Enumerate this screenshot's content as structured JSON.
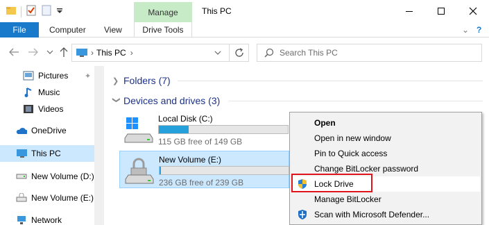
{
  "window": {
    "title": "This PC",
    "context_tab": "Manage"
  },
  "ribbon": {
    "tabs": [
      "File",
      "Computer",
      "View",
      "Drive Tools"
    ]
  },
  "nav": {
    "path": [
      "This PC"
    ],
    "search_placeholder": "Search This PC"
  },
  "sidebar": {
    "items": [
      {
        "label": "Pictures",
        "icon": "pictures-icon",
        "pinned": true
      },
      {
        "label": "Music",
        "icon": "music-icon"
      },
      {
        "label": "Videos",
        "icon": "videos-icon"
      },
      {
        "label": "OneDrive",
        "icon": "onedrive-icon"
      },
      {
        "label": "This PC",
        "icon": "this-pc-icon",
        "selected": true
      },
      {
        "label": "New Volume (D:)",
        "icon": "drive-icon"
      },
      {
        "label": "New Volume (E:)",
        "icon": "drive-icon"
      },
      {
        "label": "Network",
        "icon": "network-icon"
      }
    ]
  },
  "main": {
    "folders_header": "Folders (7)",
    "devices_header": "Devices and drives (3)",
    "drives": [
      {
        "name": "Local Disk (C:)",
        "free": "115 GB free of 149 GB",
        "used_fraction": 0.23
      },
      {
        "name": "New Volume (E:)",
        "free": "236 GB free of 239 GB",
        "used_fraction": 0.01,
        "selected": true
      }
    ]
  },
  "context_menu": {
    "items": [
      {
        "label": "Open",
        "bold": true
      },
      {
        "label": "Open in new window"
      },
      {
        "label": "Pin to Quick access"
      },
      {
        "label": "Change BitLocker password"
      },
      {
        "label": "Lock Drive",
        "icon": "shield-icon",
        "highlighted": true
      },
      {
        "label": "Manage BitLocker"
      },
      {
        "label": "Scan with Microsoft Defender...",
        "icon": "defender-icon"
      }
    ]
  },
  "colors": {
    "accent": "#1979ca",
    "manage_tab": "#c7ebc7",
    "selection": "#cce8ff",
    "drive_fill": "#26a0da",
    "highlight_box": "#e0141b",
    "group_header": "#1e3287"
  }
}
